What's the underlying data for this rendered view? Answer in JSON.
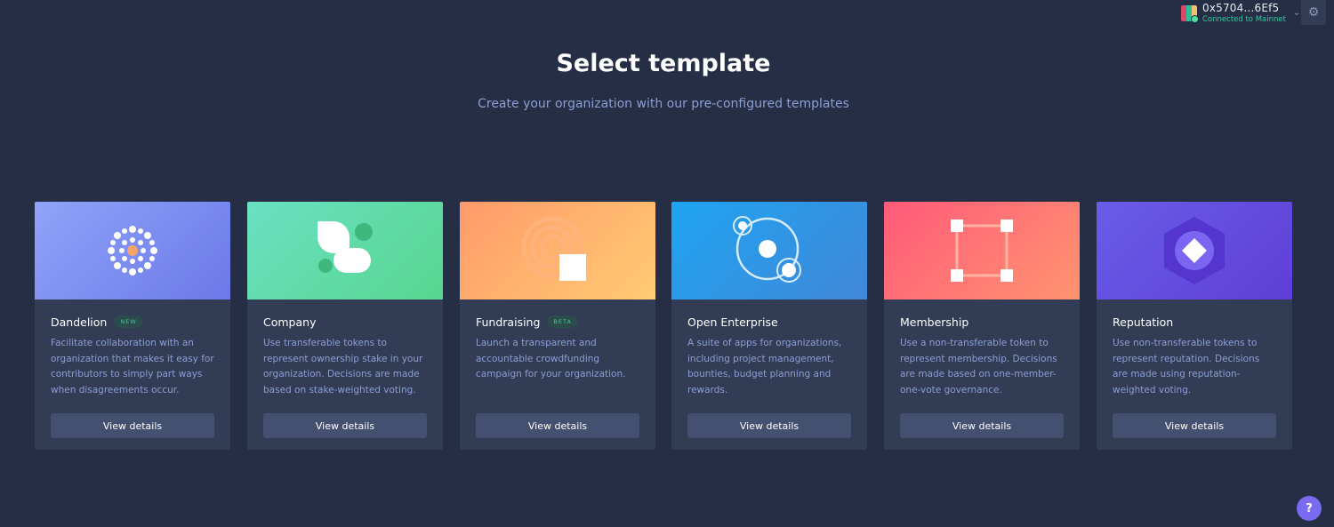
{
  "account": {
    "address": "0x5704...6Ef5",
    "network": "Connected to Mainnet"
  },
  "header": {
    "title": "Select template",
    "subtitle": "Create your organization with our pre-configured templates"
  },
  "templates": [
    {
      "name": "Dandelion",
      "badge": "NEW",
      "description": "Facilitate collaboration with an organization that makes it easy for contributors to simply part ways when disagreements occur.",
      "button": "View details",
      "gradient": [
        "#8fa4f8",
        "#6c78e9"
      ]
    },
    {
      "name": "Company",
      "badge": "",
      "description": "Use transferable tokens to represent ownership stake in your organization. Decisions are made based on stake-weighted voting.",
      "button": "View details",
      "gradient": [
        "#6ae0c2",
        "#57d68f"
      ]
    },
    {
      "name": "Fundraising",
      "badge": "BETA",
      "description": "Launch a transparent and accountable crowdfunding campaign for your organization.",
      "button": "View details",
      "gradient": [
        "#ff9a6a",
        "#ffcb73"
      ]
    },
    {
      "name": "Open Enterprise",
      "badge": "",
      "description": "A suite of apps for organizations, including project management, bounties, budget planning and rewards.",
      "button": "View details",
      "gradient": [
        "#1ea4f2",
        "#4287d8"
      ]
    },
    {
      "name": "Membership",
      "badge": "",
      "description": "Use a non-transferable token to represent membership. Decisions are made based on one-member-one-vote governance.",
      "button": "View details",
      "gradient": [
        "#ff5a7a",
        "#ff9470"
      ]
    },
    {
      "name": "Reputation",
      "badge": "",
      "description": "Use non-transferable tokens to represent reputation. Decisions are made using reputation-weighted voting.",
      "button": "View details",
      "gradient": [
        "#6a5ce8",
        "#5e3fd6"
      ]
    }
  ],
  "icons": {
    "settings": "gear-icon",
    "help": "help-icon",
    "account_chevron": "chevron-down-icon"
  },
  "help_label": "?"
}
